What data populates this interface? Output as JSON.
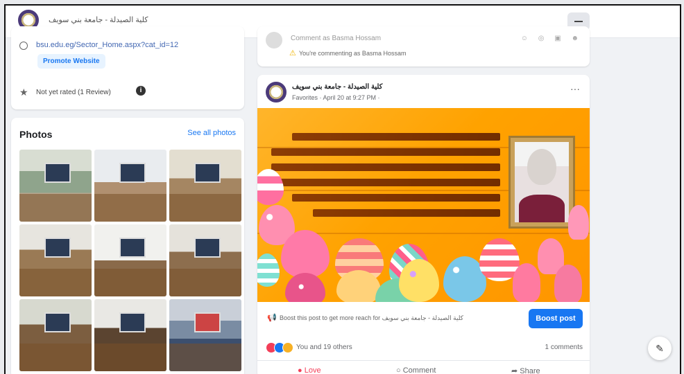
{
  "header": {
    "page_name": "كلية الصيدلة - جامعة بني سويف"
  },
  "about": {
    "website": "bsu.edu.eg/Sector_Home.aspx?cat_id=12",
    "promote_label": "Promote Website",
    "rating_text": "Not yet rated (1 Review)"
  },
  "photos": {
    "title": "Photos",
    "see_all": "See all photos"
  },
  "comment_box": {
    "placeholder": "Comment as Basma Hossam",
    "notice": "You're commenting as Basma Hossam"
  },
  "post": {
    "page_name": "كلية الصيدلة - جامعة بني سويف",
    "meta": "Favorites · April 20 at 9:27 PM ·",
    "boost_text": "Boost this post to get more reach for كلية الصيدلة - جامعة بني سويف",
    "boost_button": "Boost post",
    "reactions_text": "You and 19 others",
    "comments_count": "1 comments",
    "actions": {
      "love": "Love",
      "comment": "Comment",
      "share": "Share"
    }
  },
  "colors": {
    "brand_blue": "#1877f2",
    "love_red": "#f33e58",
    "post_image_orange": "#ffa200"
  },
  "icons": {
    "globe": "globe-icon",
    "star": "star-icon",
    "info": "info-icon",
    "warning": "warning-icon",
    "megaphone": "megaphone-icon",
    "compose": "compose-icon"
  }
}
